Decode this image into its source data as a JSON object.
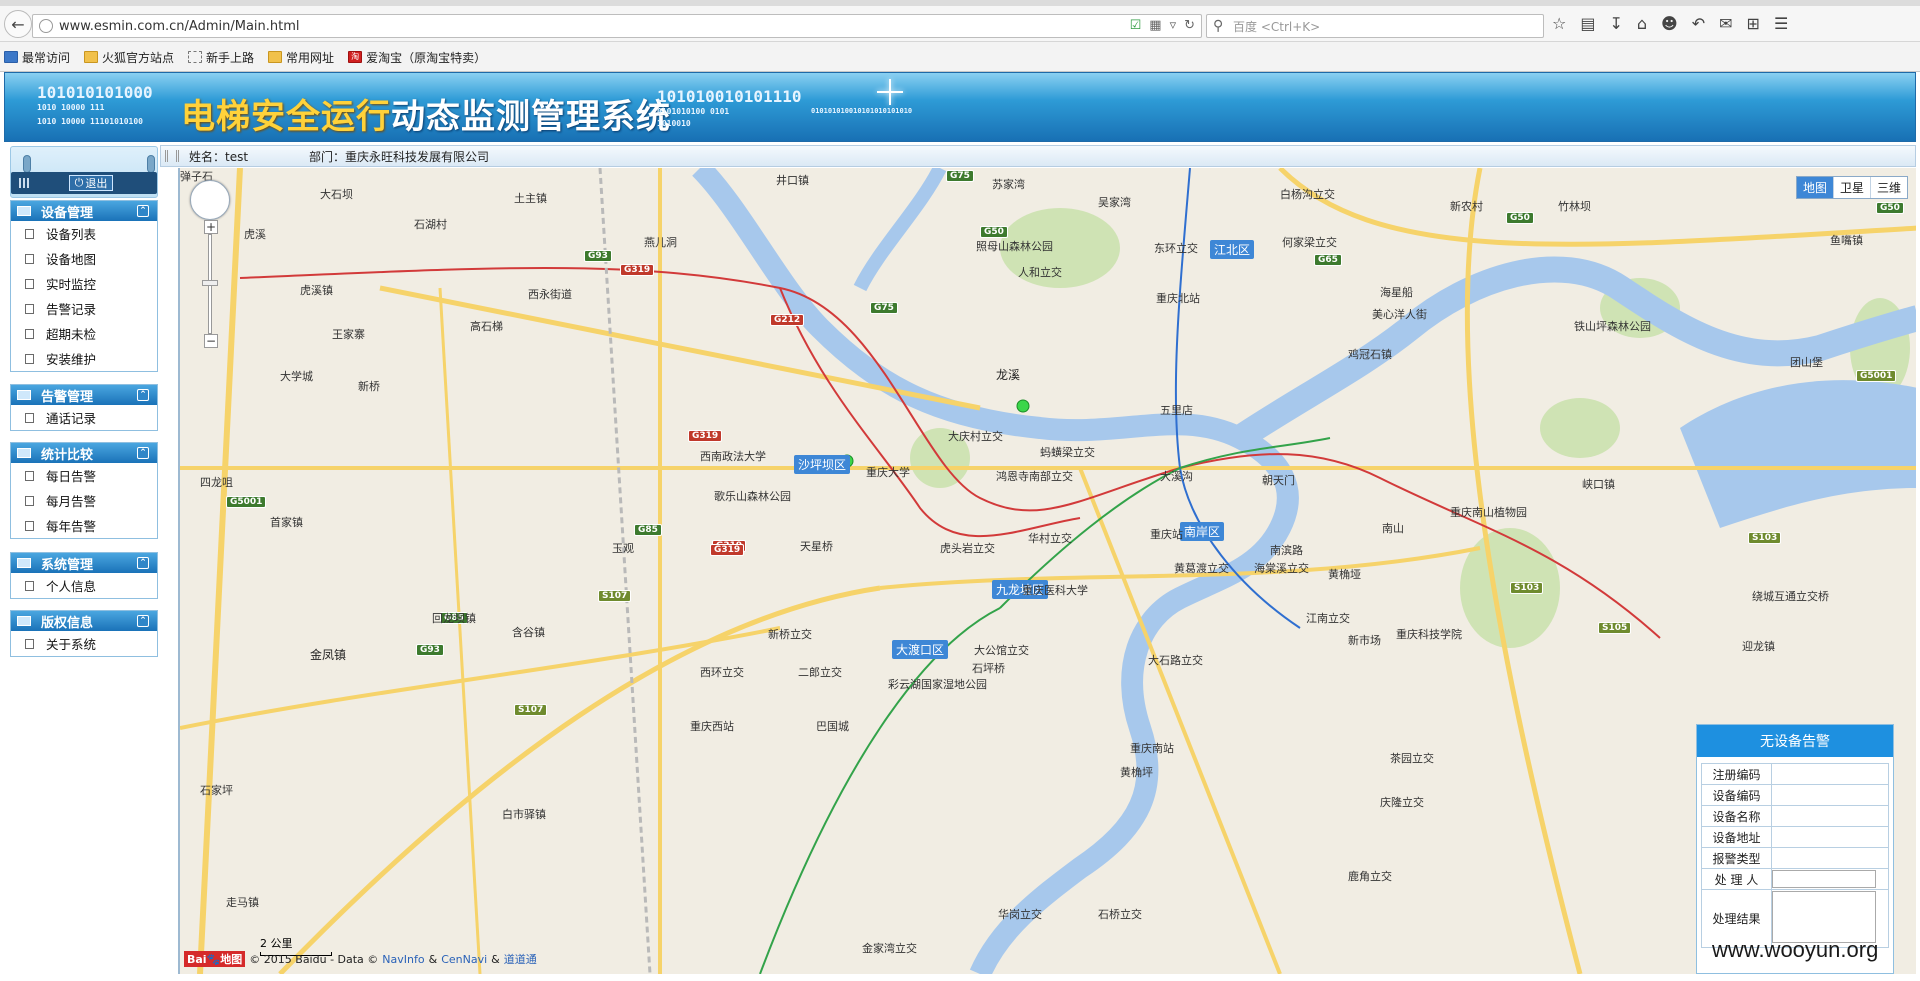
{
  "browser": {
    "url": "www.esmin.com.cn/Admin/Main.html",
    "search_placeholder": "百度 <Ctrl+K>",
    "bookmarks": [
      "最常访问",
      "火狐官方站点",
      "新手上路",
      "常用网址",
      "爱淘宝（原淘宝特卖）"
    ]
  },
  "header": {
    "title_part1": "电梯安全运行",
    "title_part2": "动态监测管理系统",
    "binary_left_1": "101010101000",
    "binary_left_2": "1010 10000 111",
    "binary_left_3": "1010 10000 11101010100",
    "binary_right_1": "101010010101110",
    "binary_right_2": "0101010100 0101",
    "binary_right_3": "010101010010101010101010",
    "binary_right_4": "1010010"
  },
  "user": {
    "name_label": "姓名：test",
    "dept_label": "部门：重庆永旺科技发展有限公司",
    "logout_label": "退出"
  },
  "menu": [
    {
      "title": "设备管理",
      "items": [
        "设备列表",
        "设备地图",
        "实时监控",
        "告警记录",
        "超期未检",
        "安装维护"
      ]
    },
    {
      "title": "告警管理",
      "items": [
        "通话记录"
      ]
    },
    {
      "title": "统计比较",
      "items": [
        "每日告警",
        "每月告警",
        "每年告警"
      ]
    },
    {
      "title": "系统管理",
      "items": [
        "个人信息"
      ]
    },
    {
      "title": "版权信息",
      "items": [
        "关于系统"
      ]
    }
  ],
  "map": {
    "types": [
      "地图",
      "卫星",
      "三维"
    ],
    "active_type": "地图",
    "scale_label": "2 公里",
    "copyright": "© 2015 Baidu - Data ©",
    "provider_1": "NavInfo",
    "amp": "&",
    "provider_2": "CenNavi",
    "provider_3": "道道通",
    "logo": "Bai",
    "logo_suffix": "地图",
    "districts": [
      "江北区",
      "沙坪坝区",
      "南岸区",
      "九龙坡区",
      "大渡口区"
    ],
    "labels": [
      "井口镇",
      "土主镇",
      "石湖村",
      "大石坝",
      "燕儿洞",
      "苏家湾",
      "吴家湾",
      "白杨沟立交",
      "新农村",
      "竹林坝",
      "鱼嘴镇",
      "东环立交",
      "何家梁立交",
      "人和立交",
      "照母山森林公园",
      "重庆北站",
      "海星船",
      "美心洋人街",
      "铁山坪森林公园",
      "五里店",
      "弹子石",
      "鸡冠石镇",
      "龙溪",
      "大庆村立交",
      "蚂蟥梁立交",
      "大溪沟",
      "朝天门",
      "鸿恩寺南部立交",
      "重庆大学",
      "西南政法大学",
      "歌乐山森林公园",
      "天星桥",
      "虎头岩立交",
      "华村立交",
      "重庆站",
      "南滨路",
      "黄葛渡立交",
      "海棠溪立交",
      "黄桷垭",
      "南山",
      "重庆南山植物园",
      "峡口镇",
      "新桥立交",
      "重庆医科大学",
      "大公馆立交",
      "石坪桥",
      "大石路立交",
      "江南立交",
      "新市场",
      "西环立交",
      "二郎立交",
      "彩云湖国家湿地公园",
      "重庆西站",
      "巴国城",
      "重庆南站",
      "黄桷坪",
      "茶园立交",
      "庆隆立交",
      "虎溪镇",
      "西永街道",
      "高石梯",
      "虎溪",
      "王家寨",
      "新桥",
      "大学城",
      "含谷镇",
      "金凤镇",
      "白市驿镇",
      "走马镇",
      "华岗立交",
      "金家湾立交",
      "鹿角立交",
      "石桥立交",
      "迎龙镇",
      "绕城互通立交桥",
      "首家镇",
      "四龙咀",
      "石家坪",
      "玉观",
      "回龙坝镇",
      "团山堡",
      "重庆科技学院"
    ]
  },
  "alarm_panel": {
    "title": "无设备告警",
    "fields": [
      "注册编码",
      "设备编码",
      "设备名称",
      "设备地址",
      "报警类型",
      "处 理 人",
      "处理结果"
    ]
  },
  "watermark": "www.wooyun.org"
}
